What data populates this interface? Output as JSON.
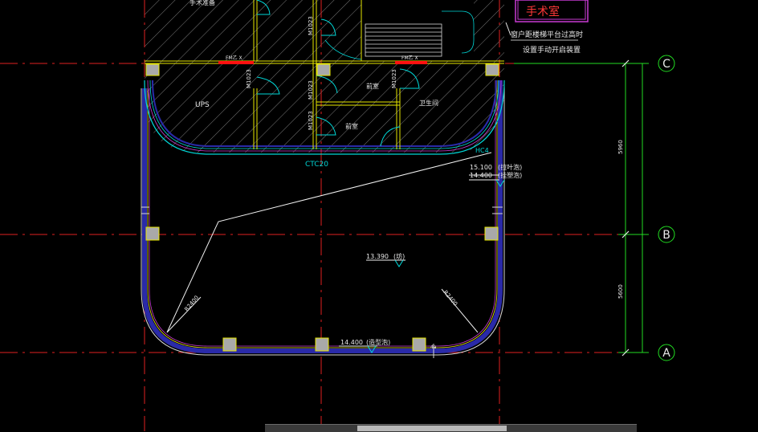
{
  "drawing": {
    "colors": {
      "background": "#000000",
      "axis_line": "#e02020",
      "wall_blue": "#2a2aa8",
      "wall_outline": "#d8d8d8",
      "cyan_line": "#00d7d7",
      "magenta_line": "#c83ad2",
      "yellow_line": "#e6e600",
      "green_dim": "#22dd22",
      "text_white": "#e8e8e8",
      "text_yellow": "#e6e600",
      "text_red": "#ff3838",
      "column_fill": "#a9a9a9",
      "red_bar": "#ff1010"
    },
    "axis_labels": {
      "c": "C",
      "b": "B",
      "a": "A"
    },
    "labels": {
      "operating_room": "手术室",
      "note_line1": "窗户距楼梯平台过高时",
      "note_line2": "设置手动开启装置",
      "ups": "UPS",
      "ctc": "CTC20",
      "hc": "HC4",
      "elev_15100": "15.100",
      "elev_14400_right": "14.400",
      "elev_note_1": "(拉叶泡)",
      "elev_note_2": "(挂塑泡)",
      "elev_13390": "13.390",
      "elev_13390_note": "(坊)",
      "elev_14400_bottom": "14.400",
      "elev_14400_bottom_note": "(造型泡)",
      "door_fm1": "FM乙 X",
      "door_fm2": "FM乙 X",
      "door_m1": "M1023",
      "door_m2": "M1023",
      "door_m3": "M1023",
      "door_m4": "M1023",
      "door_m5": "M1023",
      "room_top_left": "手术准备",
      "room_mid1": "前室",
      "room_mid2": "前室",
      "room_right": "卫生间",
      "dim_left_curve": "R2400",
      "dim_right_curve": "R2400",
      "dim_upper": "5960",
      "dim_lower": "5600",
      "small_tag": "4a"
    }
  }
}
